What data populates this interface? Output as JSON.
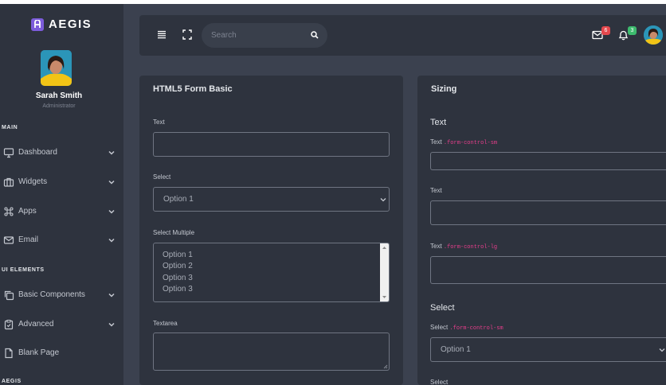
{
  "brand": {
    "name": "AEGIS",
    "logo_letter": "A"
  },
  "user": {
    "name": "Sarah Smith",
    "role": "Administrator"
  },
  "sidebar": {
    "sections": [
      "MAIN",
      "UI ELEMENTS",
      "AEGIS"
    ],
    "items": [
      {
        "label": "Dashboard",
        "icon": "monitor-icon"
      },
      {
        "label": "Widgets",
        "icon": "briefcase-icon"
      },
      {
        "label": "Apps",
        "icon": "command-icon"
      },
      {
        "label": "Email",
        "icon": "mail-icon"
      },
      {
        "label": "Basic Components",
        "icon": "copy-icon"
      },
      {
        "label": "Advanced",
        "icon": "clipboard-icon"
      },
      {
        "label": "Blank Page",
        "icon": "file-icon"
      }
    ]
  },
  "header": {
    "search_placeholder": "Search",
    "mail_count": "6",
    "notification_count": "3"
  },
  "form_basic": {
    "title": "HTML5 Form Basic",
    "text_label": "Text",
    "select_label": "Select",
    "select_value": "Option 1",
    "multi_label": "Select Multiple",
    "multi_options": [
      "Option 1",
      "Option 2",
      "Option 3",
      "Option 3"
    ],
    "textarea_label": "Textarea"
  },
  "sizing": {
    "title": "Sizing",
    "text_heading": "Text",
    "text_sm_label": "Text",
    "text_sm_class": ".form-control-sm",
    "text_label": "Text",
    "text_lg_label": "Text",
    "text_lg_class": ".form-control-lg",
    "select_heading": "Select",
    "select_sm_label": "Select",
    "select_sm_class": ".form-control-sm",
    "select_sm_value": "Option 1",
    "select_label": "Select"
  },
  "colors": {
    "background": "#3b414f",
    "panel": "#2e333e",
    "accent": "#7c5cdb",
    "code": "#e83e8c",
    "badge_red": "#e5484d",
    "badge_green": "#3dbb6e"
  }
}
